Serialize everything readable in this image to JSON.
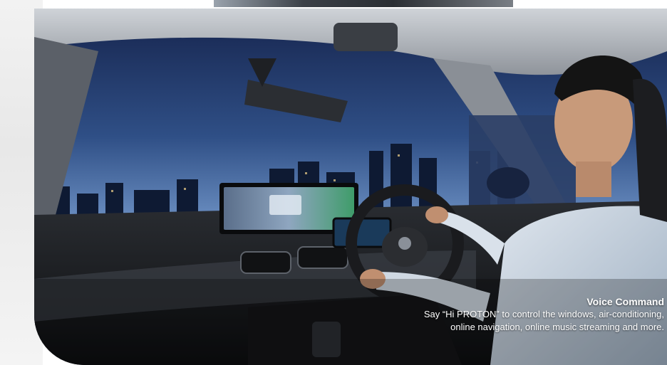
{
  "caption": {
    "title": "Voice Command",
    "line1": "Say “Hi PROTON” to control the windows, air-conditioning,",
    "line2": "online navigation, online music streaming and more."
  },
  "colors": {
    "sky_top": "#1a2a5a",
    "sky_bottom": "#4a6fa8",
    "dashboard": "#1b1d21",
    "caption_text": "#ffffff"
  }
}
